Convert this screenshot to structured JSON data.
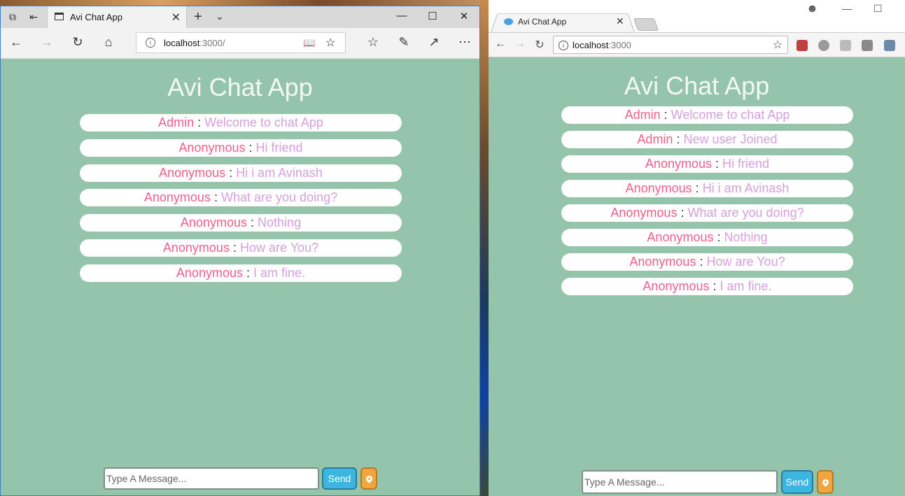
{
  "edge": {
    "tab_title": "Avi Chat App",
    "url_host": "localhost",
    "url_path": ":3000/",
    "icons": [
      "tab-preview-icon",
      "set-aside-tabs-icon",
      "page-icon",
      "close-tab-icon",
      "new-tab-icon",
      "tab-list-chevron-icon",
      "minimize-icon",
      "maximize-icon",
      "close-window-icon",
      "back-icon",
      "forward-icon",
      "refresh-icon",
      "home-icon",
      "info-icon",
      "reading-view-icon",
      "favorite-star-icon",
      "favorites-hub-icon",
      "pen-icon",
      "share-icon",
      "more-icon"
    ]
  },
  "chrome": {
    "tab_title": "Avi Chat App",
    "url_host": "localhost",
    "url_path": ":3000",
    "icons": [
      "chat-favicon-icon",
      "close-tab-icon",
      "profile-icon",
      "minimize-icon",
      "maximize-icon",
      "back-icon",
      "forward-icon",
      "reload-icon",
      "info-icon",
      "bookmark-star-icon",
      "extension-icons"
    ]
  },
  "app": {
    "title": "Avi Chat App",
    "separator": ":",
    "input_placeholder": "Type A Message...",
    "send_label": "Send",
    "colors": {
      "background": "#94c4a9",
      "title": "#f4f9ef",
      "sender": "#f2608a",
      "text": "#d6a0de",
      "send_button": "#3cb6e0",
      "location_button": "#f0a53e"
    }
  },
  "edge_messages": [
    {
      "sender": "Admin",
      "text": "Welcome to chat App"
    },
    {
      "sender": "Anonymous",
      "text": "Hi friend"
    },
    {
      "sender": "Anonymous",
      "text": "Hi i am Avinash"
    },
    {
      "sender": "Anonymous",
      "text": "What are you doing?"
    },
    {
      "sender": "Anonymous",
      "text": "Nothing"
    },
    {
      "sender": "Anonymous",
      "text": "How are You?"
    },
    {
      "sender": "Anonymous",
      "text": "I am fine."
    }
  ],
  "chrome_messages": [
    {
      "sender": "Admin",
      "text": "Welcome to chat App"
    },
    {
      "sender": "Admin",
      "text": "New user Joined"
    },
    {
      "sender": "Anonymous",
      "text": "Hi friend"
    },
    {
      "sender": "Anonymous",
      "text": "Hi i am Avinash"
    },
    {
      "sender": "Anonymous",
      "text": "What are you doing?"
    },
    {
      "sender": "Anonymous",
      "text": "Nothing"
    },
    {
      "sender": "Anonymous",
      "text": "How are You?"
    },
    {
      "sender": "Anonymous",
      "text": "I am fine."
    }
  ]
}
